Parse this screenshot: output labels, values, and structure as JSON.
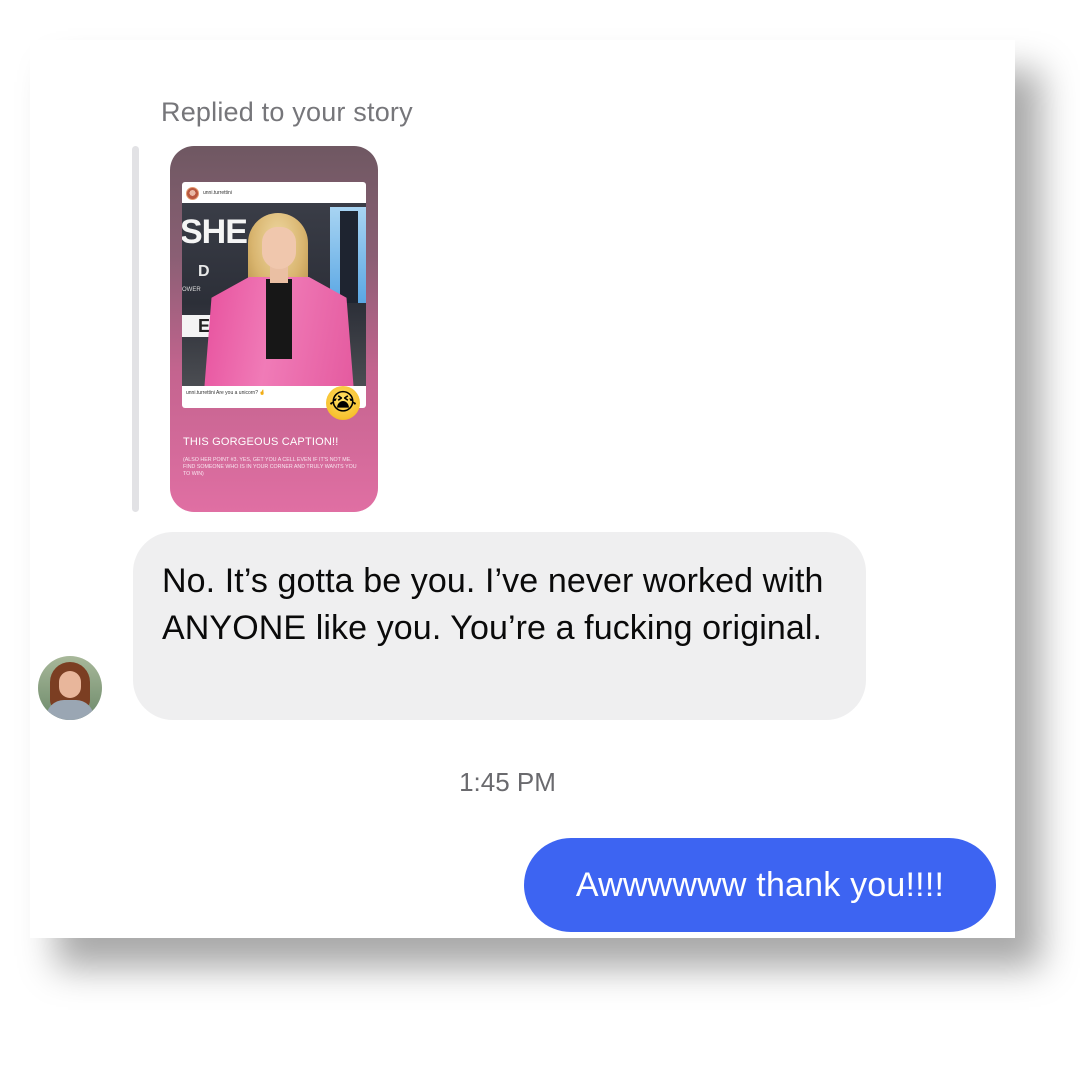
{
  "thread": {
    "replied_label": "Replied to your story",
    "story": {
      "post_username": "unni.turrettini",
      "post_caption": "unni.turrettini Are you a unicorn? 🤞",
      "sign_text": "SHE",
      "sign_d": "D",
      "sign_ower": "OWER",
      "sign_e": "E",
      "sticker_emoji": "😭",
      "title": "THIS GORGEOUS CAPTION!!",
      "subtitle": "(ALSO HER POINT #3. YES, GET YOU A CELL EVEN IF IT'S NOT ME. FIND SOMEONE WHO IS IN YOUR CORNER AND TRULY WANTS YOU TO WIN)"
    },
    "incoming_message": "No. It’s gotta be you. I’ve never worked with ANYONE like you. You’re a fucking original.",
    "timestamp": "1:45 PM",
    "outgoing_message": "Awwwwww thank you!!!!"
  },
  "colors": {
    "outgoing_bubble": "#3d64f2",
    "incoming_bubble": "#efeff0",
    "story_gradient_bottom": "#e06fa3"
  },
  "icons": {
    "story_sticker": "loudly-crying-face-emoji"
  }
}
